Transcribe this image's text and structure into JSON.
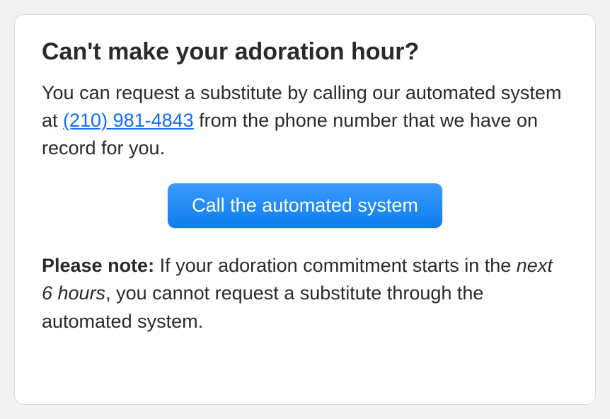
{
  "card": {
    "heading": "Can't make your adoration hour?",
    "description_pre": "You can request a substitute by calling our automated system at ",
    "phone": "(210) 981-4843",
    "description_post": " from the phone number that we have on record for you.",
    "button_label": "Call the automated system",
    "note_label": "Please note:",
    "note_pre": " If your adoration commitment starts in the ",
    "note_emphasis": "next 6 hours",
    "note_post": ", you cannot request a substitute through the automated system."
  }
}
